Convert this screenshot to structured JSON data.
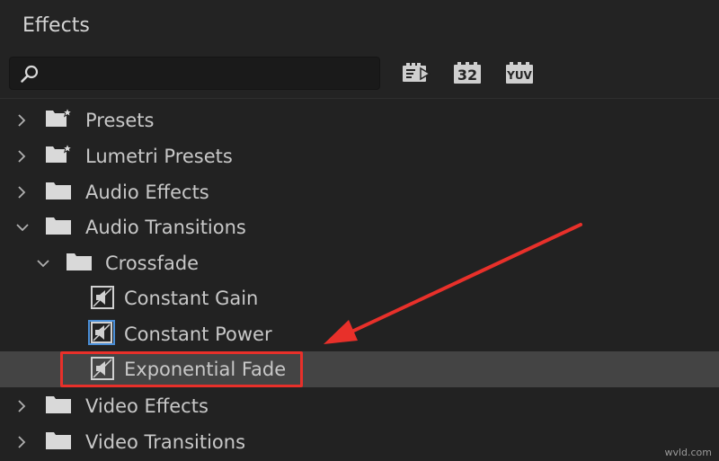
{
  "panel": {
    "title": "Effects"
  },
  "search": {
    "value": "",
    "placeholder": ""
  },
  "toolbar": {
    "accelerated_label": "",
    "bit32_label": "32",
    "yuv_label": "YUV"
  },
  "tree": {
    "items": [
      {
        "label": "Presets",
        "type": "folder-star",
        "expanded": false
      },
      {
        "label": "Lumetri Presets",
        "type": "folder-star",
        "expanded": false
      },
      {
        "label": "Audio Effects",
        "type": "folder",
        "expanded": false
      },
      {
        "label": "Audio Transitions",
        "type": "folder",
        "expanded": true
      },
      {
        "label": "Crossfade",
        "type": "folder",
        "expanded": true
      },
      {
        "label": "Constant Gain",
        "type": "effect"
      },
      {
        "label": "Constant Power",
        "type": "effect",
        "default": true
      },
      {
        "label": "Exponential Fade",
        "type": "effect",
        "selected": true
      },
      {
        "label": "Video Effects",
        "type": "folder",
        "expanded": false
      },
      {
        "label": "Video Transitions",
        "type": "folder",
        "expanded": false
      }
    ]
  },
  "annotation": {
    "highlight_color": "#e8302a"
  },
  "watermark": "wvld.com"
}
